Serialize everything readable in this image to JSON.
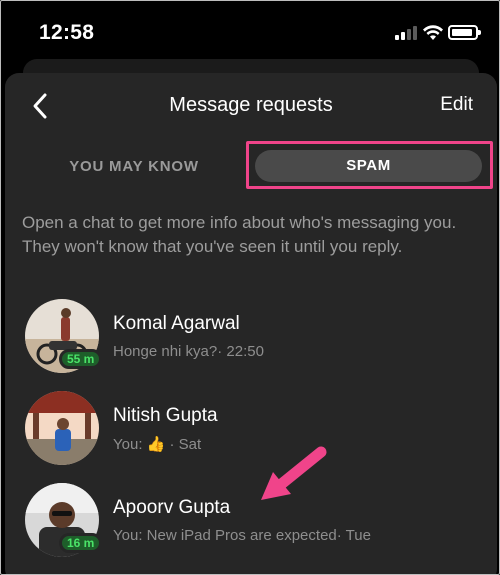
{
  "status_bar": {
    "time": "12:58",
    "icons": [
      "cellular-signal-icon",
      "wifi-icon",
      "battery-icon"
    ]
  },
  "header": {
    "title": "Message requests",
    "edit_label": "Edit",
    "back_icon": "chevron-left-icon"
  },
  "tabs": [
    {
      "label": "YOU MAY KNOW",
      "selected": false
    },
    {
      "label": "SPAM",
      "selected": true
    }
  ],
  "info_text": "Open a chat to get more info about who's messaging you. They won't know that you've seen it until you reply.",
  "conversations": [
    {
      "name": "Komal Agarwal",
      "preview": "Honge nhi kya?· 22:50",
      "active_badge": "55 m"
    },
    {
      "name": "Nitish Gupta",
      "preview_prefix": "You:",
      "preview_emoji": "👍",
      "preview_suffix": "· Sat"
    },
    {
      "name": "Apoorv Gupta",
      "preview": "You: New iPad Pros are expected· Tue",
      "active_badge": "16 m"
    }
  ],
  "colors": {
    "sheet_background": "#262626",
    "highlight": "#f0448a",
    "active_badge_text": "#4ae368",
    "selected_tab": "#4a4a4a"
  }
}
